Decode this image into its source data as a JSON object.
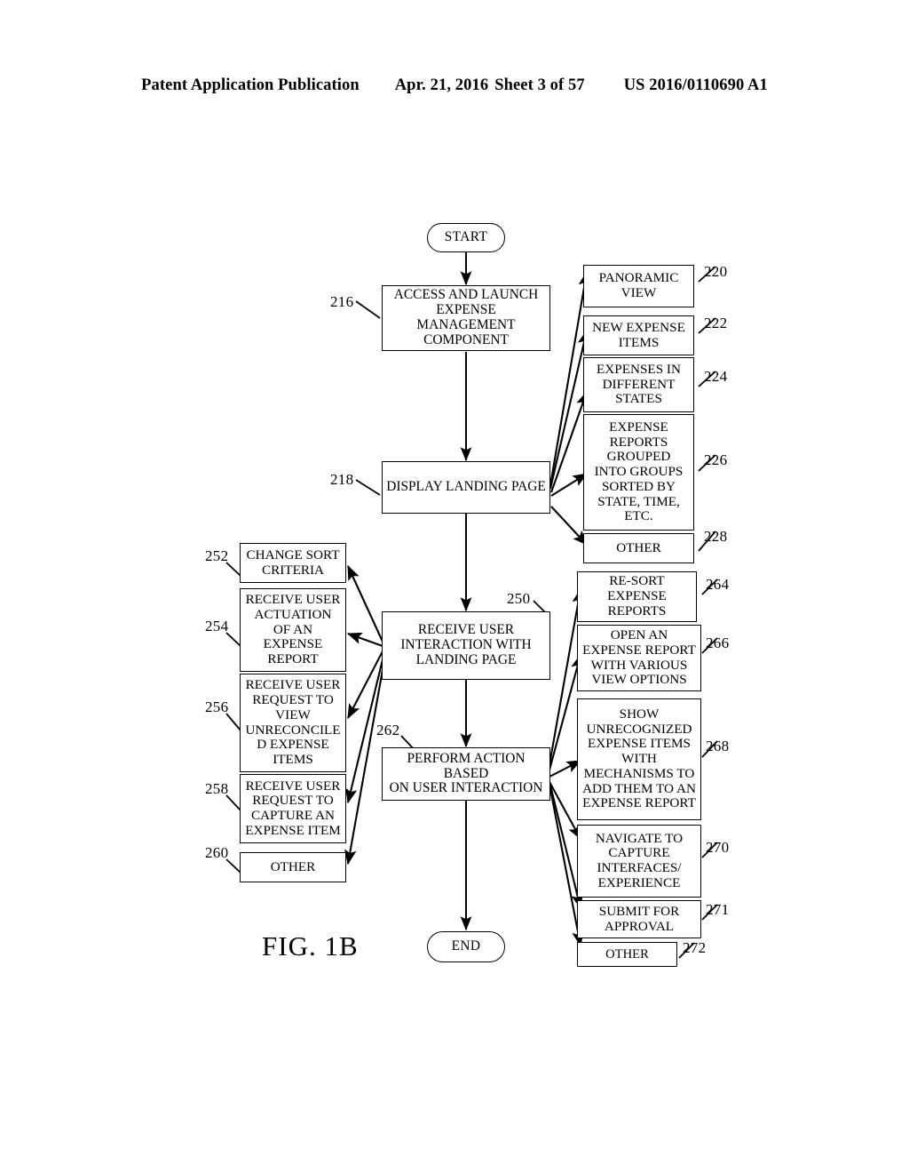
{
  "header": {
    "publication": "Patent Application Publication",
    "date": "Apr. 21, 2016",
    "sheet": "Sheet 3 of 57",
    "patent_number": "US 2016/0110690 A1"
  },
  "figure": {
    "caption": "FIG. 1B"
  },
  "nodes": {
    "start": "START",
    "end": "END",
    "n216": "ACCESS AND LAUNCH\nEXPENSE MANAGEMENT\nCOMPONENT",
    "n218": "DISPLAY LANDING PAGE",
    "n220": "PANORAMIC\nVIEW",
    "n222": "NEW EXPENSE\nITEMS",
    "n224": "EXPENSES IN\nDIFFERENT\nSTATES",
    "n226": "EXPENSE\nREPORTS\nGROUPED\nINTO GROUPS\nSORTED BY\nSTATE, TIME,\nETC.",
    "n228": "OTHER",
    "n250": "RECEIVE USER\nINTERACTION WITH\nLANDING PAGE",
    "n252": "CHANGE SORT\nCRITERIA",
    "n254": "RECEIVE USER\nACTUATION\nOF AN\nEXPENSE\nREPORT",
    "n256": "RECEIVE USER\nREQUEST TO\nVIEW\nUNRECONCILE\nD EXPENSE\nITEMS",
    "n258": "RECEIVE USER\nREQUEST TO\nCAPTURE AN\nEXPENSE ITEM",
    "n260": "OTHER",
    "n262": "PERFORM ACTION BASED\nON USER INTERACTION",
    "n264": "RE-SORT\nEXPENSE\nREPORTS",
    "n266": "OPEN AN\nEXPENSE REPORT\nWITH VARIOUS\nVIEW OPTIONS",
    "n268": "SHOW\nUNRECOGNIZED\nEXPENSE ITEMS\nWITH\nMECHANISMS TO\nADD THEM TO AN\nEXPENSE REPORT",
    "n270": "NAVIGATE TO\nCAPTURE\nINTERFACES/\nEXPERIENCE",
    "n271": "SUBMIT FOR\nAPPROVAL",
    "n272": "OTHER"
  },
  "refs": {
    "r216": "216",
    "r218": "218",
    "r220": "220",
    "r222": "222",
    "r224": "224",
    "r226": "226",
    "r228": "228",
    "r250": "250",
    "r252": "252",
    "r254": "254",
    "r256": "256",
    "r258": "258",
    "r260": "260",
    "r262": "262",
    "r264": "264",
    "r266": "266",
    "r268": "268",
    "r270": "270",
    "r271": "271",
    "r272": "272"
  },
  "colors": {
    "ink": "#000000",
    "paper": "#ffffff"
  }
}
